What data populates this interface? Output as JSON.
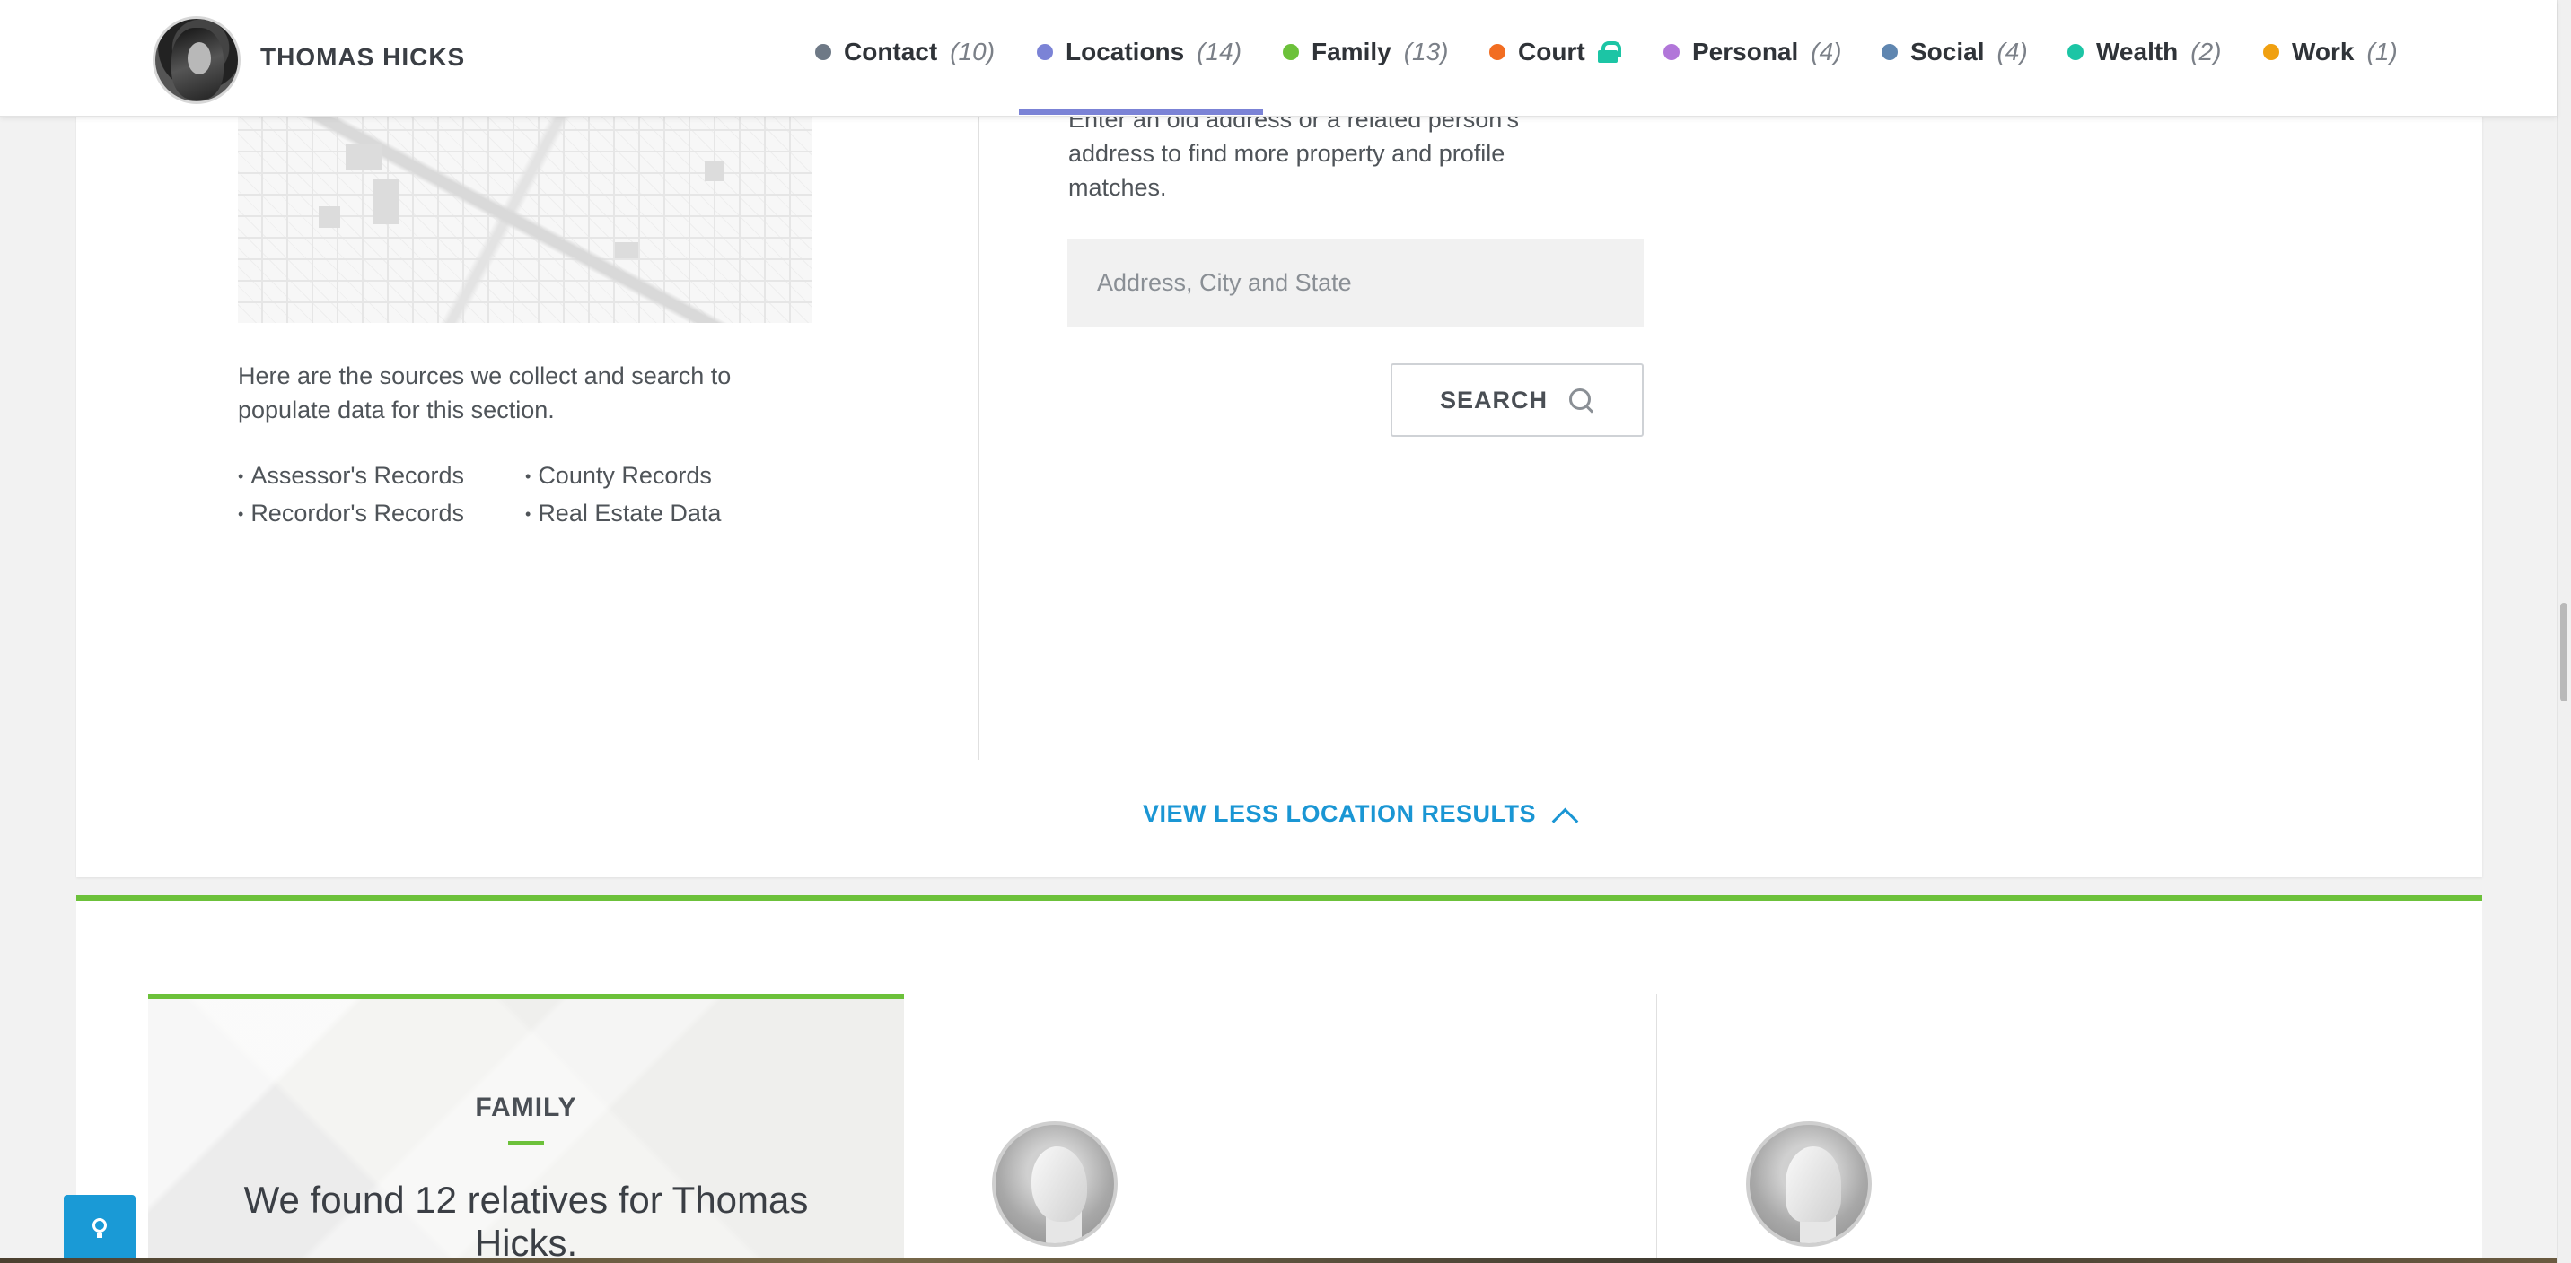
{
  "header": {
    "name": "THOMAS HICKS",
    "nav": [
      {
        "label": "Contact",
        "count": "(10)",
        "color": "#6e7986",
        "locked": false
      },
      {
        "label": "Locations",
        "count": "(14)",
        "color": "#7b83d6",
        "locked": false,
        "active": true
      },
      {
        "label": "Family",
        "count": "(13)",
        "color": "#6cc13a",
        "locked": false
      },
      {
        "label": "Court",
        "count": "",
        "color": "#f26d21",
        "locked": true
      },
      {
        "label": "Personal",
        "count": "(4)",
        "color": "#b176d9",
        "locked": false
      },
      {
        "label": "Social",
        "count": "(4)",
        "color": "#5f86b0",
        "locked": false
      },
      {
        "label": "Wealth",
        "count": "(2)",
        "color": "#1cc5a5",
        "locked": false
      },
      {
        "label": "Work",
        "count": "(1)",
        "color": "#f0a010",
        "locked": false
      }
    ]
  },
  "locations": {
    "sources_intro": "Here are the sources we collect and search to populate data for this section.",
    "sources": [
      "Assessor's Records",
      "County Records",
      "Recordor's Records",
      "Real Estate Data"
    ],
    "address_help": "Enter an old address or a related person's address to find more property and profile matches.",
    "address_placeholder": "Address, City and State",
    "search_label": "SEARCH",
    "view_less_label": "VIEW LESS LOCATION RESULTS"
  },
  "family": {
    "heading": "FAMILY",
    "summary": "We found 12 relatives for Thomas Hicks."
  },
  "colors": {
    "accent_blue": "#1a96d4",
    "family_green": "#6cc13a",
    "locations_purple": "#7b83d6"
  }
}
